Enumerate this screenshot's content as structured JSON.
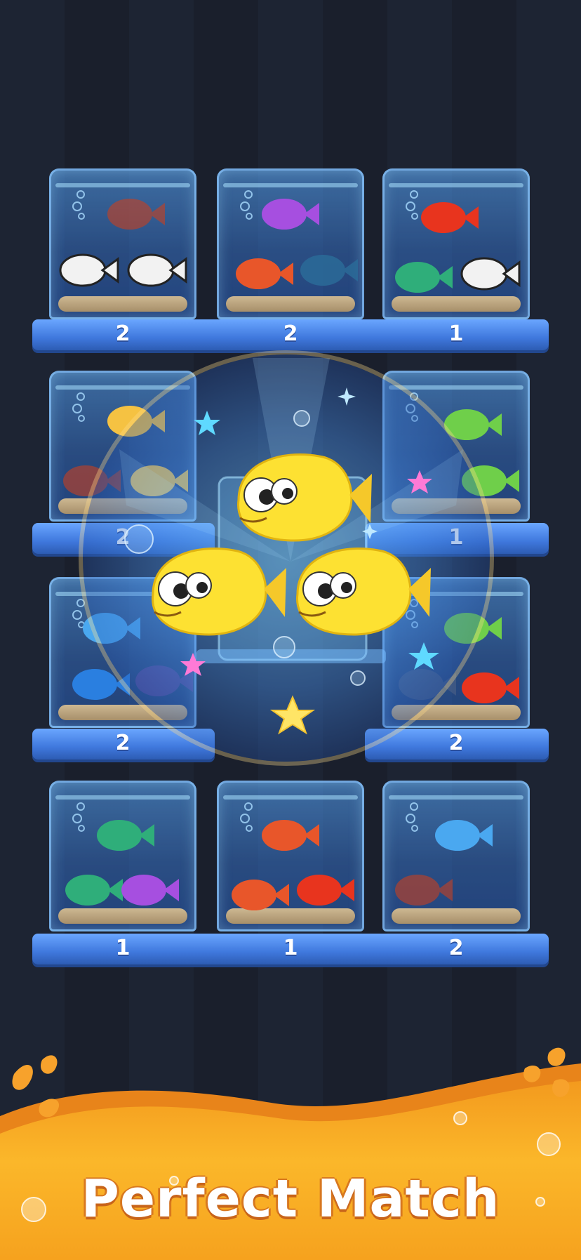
{
  "shelves": [
    {
      "counts": [
        "2",
        "2",
        "1"
      ]
    },
    {
      "counts": [
        "2",
        "1"
      ]
    },
    {
      "counts": [
        "2",
        "2"
      ]
    },
    {
      "counts": [
        "1",
        "1",
        "2"
      ]
    }
  ],
  "banner": {
    "title": "Perfect Match"
  },
  "colors": {
    "background": "#1b2130",
    "shelf": "#4a86e8",
    "banner": "#f6a21e",
    "title_outline": "#c8641a"
  },
  "icons": [
    "fish-icon",
    "star-icon",
    "bubble-icon"
  ]
}
